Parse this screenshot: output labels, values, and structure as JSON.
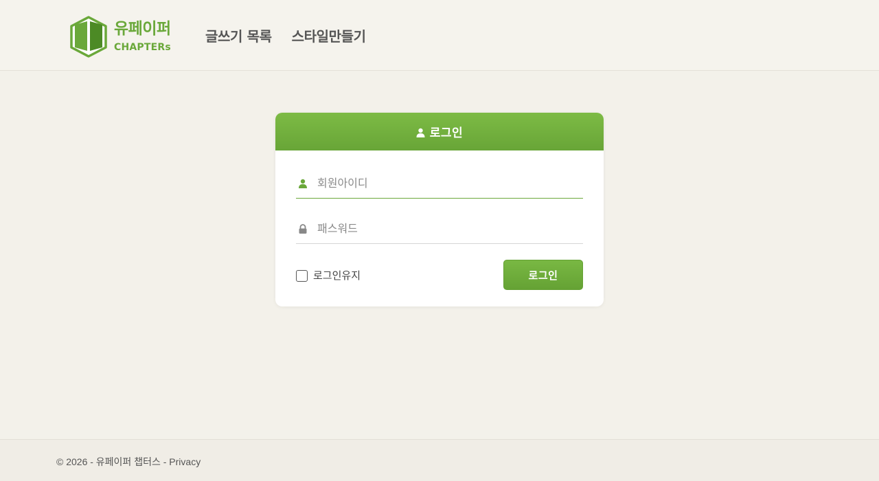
{
  "header": {
    "logo": {
      "name_ko": "유페이퍼",
      "name_en": "CHAPTERs"
    },
    "nav": [
      {
        "label": "글쓰기 목록"
      },
      {
        "label": "스타일만들기"
      }
    ]
  },
  "login": {
    "title": "로그인",
    "id_field": {
      "placeholder": "회원아이디",
      "value": ""
    },
    "password_field": {
      "placeholder": "패스워드",
      "value": ""
    },
    "remember_label": "로그인유지",
    "remember_checked": false,
    "submit_label": "로그인"
  },
  "footer": {
    "copyright": "© 2026 - 유페이퍼 챕터스 - ",
    "privacy_link": "Privacy"
  },
  "colors": {
    "brand_green": "#6aa83a",
    "page_background": "#f3f1ea",
    "card_background": "#ffffff"
  },
  "icons": {
    "logo": "book-hexagon-logo",
    "header_user": "user-icon",
    "id_field": "user-icon",
    "password_field": "lock-icon"
  }
}
